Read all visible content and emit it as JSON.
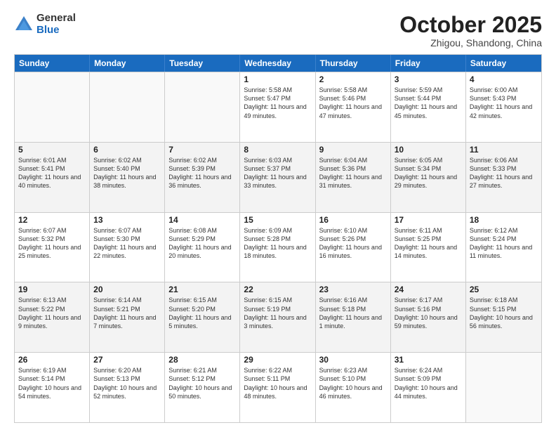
{
  "logo": {
    "general": "General",
    "blue": "Blue"
  },
  "header": {
    "month": "October 2025",
    "location": "Zhigou, Shandong, China"
  },
  "weekdays": [
    "Sunday",
    "Monday",
    "Tuesday",
    "Wednesday",
    "Thursday",
    "Friday",
    "Saturday"
  ],
  "rows": [
    [
      {
        "day": "",
        "info": ""
      },
      {
        "day": "",
        "info": ""
      },
      {
        "day": "",
        "info": ""
      },
      {
        "day": "1",
        "info": "Sunrise: 5:58 AM\nSunset: 5:47 PM\nDaylight: 11 hours\nand 49 minutes."
      },
      {
        "day": "2",
        "info": "Sunrise: 5:58 AM\nSunset: 5:46 PM\nDaylight: 11 hours\nand 47 minutes."
      },
      {
        "day": "3",
        "info": "Sunrise: 5:59 AM\nSunset: 5:44 PM\nDaylight: 11 hours\nand 45 minutes."
      },
      {
        "day": "4",
        "info": "Sunrise: 6:00 AM\nSunset: 5:43 PM\nDaylight: 11 hours\nand 42 minutes."
      }
    ],
    [
      {
        "day": "5",
        "info": "Sunrise: 6:01 AM\nSunset: 5:41 PM\nDaylight: 11 hours\nand 40 minutes."
      },
      {
        "day": "6",
        "info": "Sunrise: 6:02 AM\nSunset: 5:40 PM\nDaylight: 11 hours\nand 38 minutes."
      },
      {
        "day": "7",
        "info": "Sunrise: 6:02 AM\nSunset: 5:39 PM\nDaylight: 11 hours\nand 36 minutes."
      },
      {
        "day": "8",
        "info": "Sunrise: 6:03 AM\nSunset: 5:37 PM\nDaylight: 11 hours\nand 33 minutes."
      },
      {
        "day": "9",
        "info": "Sunrise: 6:04 AM\nSunset: 5:36 PM\nDaylight: 11 hours\nand 31 minutes."
      },
      {
        "day": "10",
        "info": "Sunrise: 6:05 AM\nSunset: 5:34 PM\nDaylight: 11 hours\nand 29 minutes."
      },
      {
        "day": "11",
        "info": "Sunrise: 6:06 AM\nSunset: 5:33 PM\nDaylight: 11 hours\nand 27 minutes."
      }
    ],
    [
      {
        "day": "12",
        "info": "Sunrise: 6:07 AM\nSunset: 5:32 PM\nDaylight: 11 hours\nand 25 minutes."
      },
      {
        "day": "13",
        "info": "Sunrise: 6:07 AM\nSunset: 5:30 PM\nDaylight: 11 hours\nand 22 minutes."
      },
      {
        "day": "14",
        "info": "Sunrise: 6:08 AM\nSunset: 5:29 PM\nDaylight: 11 hours\nand 20 minutes."
      },
      {
        "day": "15",
        "info": "Sunrise: 6:09 AM\nSunset: 5:28 PM\nDaylight: 11 hours\nand 18 minutes."
      },
      {
        "day": "16",
        "info": "Sunrise: 6:10 AM\nSunset: 5:26 PM\nDaylight: 11 hours\nand 16 minutes."
      },
      {
        "day": "17",
        "info": "Sunrise: 6:11 AM\nSunset: 5:25 PM\nDaylight: 11 hours\nand 14 minutes."
      },
      {
        "day": "18",
        "info": "Sunrise: 6:12 AM\nSunset: 5:24 PM\nDaylight: 11 hours\nand 11 minutes."
      }
    ],
    [
      {
        "day": "19",
        "info": "Sunrise: 6:13 AM\nSunset: 5:22 PM\nDaylight: 11 hours\nand 9 minutes."
      },
      {
        "day": "20",
        "info": "Sunrise: 6:14 AM\nSunset: 5:21 PM\nDaylight: 11 hours\nand 7 minutes."
      },
      {
        "day": "21",
        "info": "Sunrise: 6:15 AM\nSunset: 5:20 PM\nDaylight: 11 hours\nand 5 minutes."
      },
      {
        "day": "22",
        "info": "Sunrise: 6:15 AM\nSunset: 5:19 PM\nDaylight: 11 hours\nand 3 minutes."
      },
      {
        "day": "23",
        "info": "Sunrise: 6:16 AM\nSunset: 5:18 PM\nDaylight: 11 hours\nand 1 minute."
      },
      {
        "day": "24",
        "info": "Sunrise: 6:17 AM\nSunset: 5:16 PM\nDaylight: 10 hours\nand 59 minutes."
      },
      {
        "day": "25",
        "info": "Sunrise: 6:18 AM\nSunset: 5:15 PM\nDaylight: 10 hours\nand 56 minutes."
      }
    ],
    [
      {
        "day": "26",
        "info": "Sunrise: 6:19 AM\nSunset: 5:14 PM\nDaylight: 10 hours\nand 54 minutes."
      },
      {
        "day": "27",
        "info": "Sunrise: 6:20 AM\nSunset: 5:13 PM\nDaylight: 10 hours\nand 52 minutes."
      },
      {
        "day": "28",
        "info": "Sunrise: 6:21 AM\nSunset: 5:12 PM\nDaylight: 10 hours\nand 50 minutes."
      },
      {
        "day": "29",
        "info": "Sunrise: 6:22 AM\nSunset: 5:11 PM\nDaylight: 10 hours\nand 48 minutes."
      },
      {
        "day": "30",
        "info": "Sunrise: 6:23 AM\nSunset: 5:10 PM\nDaylight: 10 hours\nand 46 minutes."
      },
      {
        "day": "31",
        "info": "Sunrise: 6:24 AM\nSunset: 5:09 PM\nDaylight: 10 hours\nand 44 minutes."
      },
      {
        "day": "",
        "info": ""
      }
    ]
  ],
  "alt_rows": [
    1,
    3
  ]
}
